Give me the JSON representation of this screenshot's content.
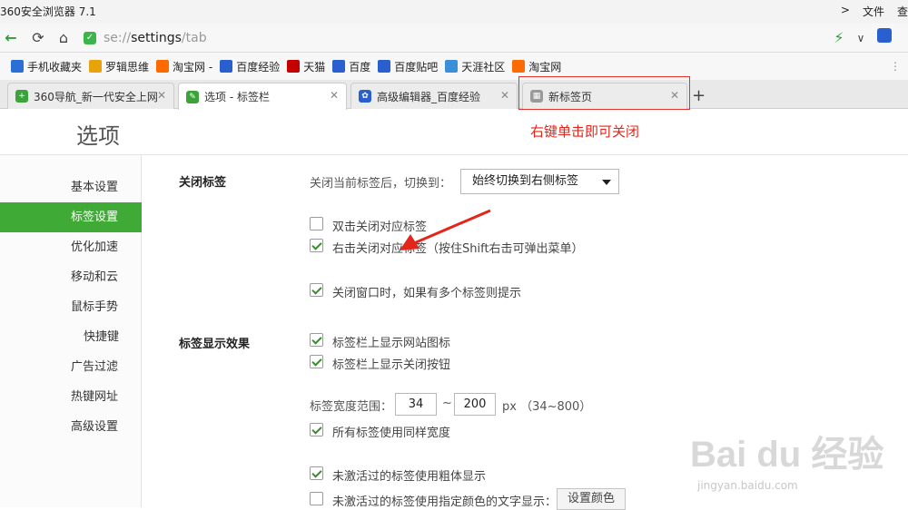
{
  "window": {
    "title": "360安全浏览器 7.1",
    "menu_file": "文件",
    "menu_view": "查"
  },
  "address": {
    "scheme": "se://",
    "host": "settings",
    "path": "/tab"
  },
  "bookmarks": [
    {
      "label": "手机收藏夹",
      "icon": "phone-icon",
      "color": "#2a6fd6"
    },
    {
      "label": "罗辑思维",
      "icon": "star-icon",
      "color": "#e8a20c"
    },
    {
      "label": "淘宝网 -",
      "icon": "taobao-icon",
      "color": "#ff6a00"
    },
    {
      "label": "百度经验",
      "icon": "baidu-paw-icon",
      "color": "#2a5fd0"
    },
    {
      "label": "天猫",
      "icon": "tmall-icon",
      "color": "#c40000"
    },
    {
      "label": "百度",
      "icon": "baidu-paw-icon",
      "color": "#2a5fd0"
    },
    {
      "label": "百度贴吧",
      "icon": "baidu-paw-icon",
      "color": "#2a5fd0"
    },
    {
      "label": "天涯社区",
      "icon": "globe-icon",
      "color": "#3a8fd8"
    },
    {
      "label": "淘宝网",
      "icon": "taobao-icon",
      "color": "#ff6a00"
    }
  ],
  "tabs": [
    {
      "label": "360导航_新一代安全上网",
      "icon": "360-icon",
      "color": "#3aa33a"
    },
    {
      "label": "选项 - 标签栏",
      "icon": "wrench-icon",
      "color": "#3aa33a"
    },
    {
      "label": "高级编辑器_百度经验",
      "icon": "baidu-paw-icon",
      "color": "#2a5fd0"
    },
    {
      "label": "新标签页",
      "icon": "grid-icon",
      "color": "#888888"
    }
  ],
  "annotation": {
    "text": "右键单击即可关闭",
    "color": "#e3261b"
  },
  "page": {
    "title": "选项"
  },
  "sidebar": [
    {
      "label": "基本设置"
    },
    {
      "label": "标签设置"
    },
    {
      "label": "优化加速"
    },
    {
      "label": "移动和云"
    },
    {
      "label": "鼠标手势"
    },
    {
      "label": "快捷键"
    },
    {
      "label": "广告过滤"
    },
    {
      "label": "热键网址"
    },
    {
      "label": "高级设置"
    }
  ],
  "close_section": {
    "heading": "关闭标签",
    "switch_label": "关闭当前标签后，切换到：",
    "switch_value": "始终切换到右侧标签",
    "options": [
      {
        "label": "双击关闭对应标签",
        "checked": false
      },
      {
        "label": "右击关闭对应标签（按住Shift右击可弹出菜单）",
        "checked": true
      },
      {
        "label": "关闭窗口时，如果有多个标签则提示",
        "checked": true
      }
    ]
  },
  "display_section": {
    "heading": "标签显示效果",
    "options": [
      {
        "label": "标签栏上显示网站图标",
        "checked": true
      },
      {
        "label": "标签栏上显示关闭按钮",
        "checked": true
      }
    ],
    "width_label": "标签宽度范围：",
    "width_min": "34",
    "width_sep": "~",
    "width_max": "200",
    "width_unit": "px （34~800）",
    "same_width": {
      "label": "所有标签使用同样宽度",
      "checked": true
    },
    "bold_inactive": {
      "label": "未激活过的标签使用粗体显示",
      "checked": true
    },
    "color_inactive": {
      "label": "未激活过的标签使用指定颜色的文字显示：",
      "checked": false
    },
    "color_button": "设置颜色"
  },
  "watermark": {
    "brand": "Bai du 经验",
    "url": "jingyan.baidu.com"
  }
}
